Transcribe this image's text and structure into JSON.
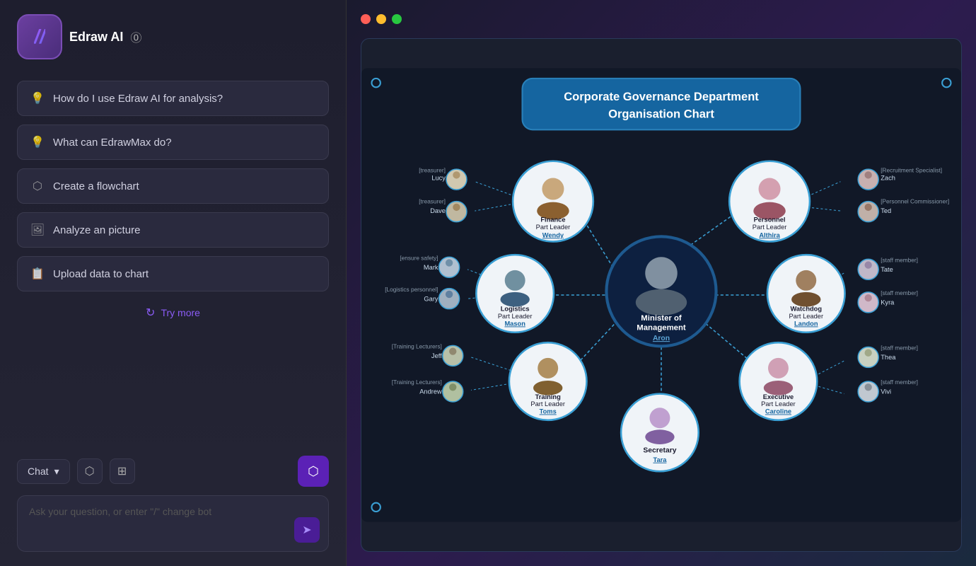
{
  "header": {
    "title": "Edraw AI",
    "help": "?"
  },
  "suggestions": [
    {
      "id": "analysis",
      "icon": "💡",
      "label": "How do I use Edraw AI for analysis?"
    },
    {
      "id": "edrawmax",
      "icon": "💡",
      "label": "What can EdrawMax do?"
    },
    {
      "id": "flowchart",
      "icon": "📊",
      "label": "Create a flowchart"
    },
    {
      "id": "picture",
      "icon": "🖼",
      "label": "Analyze an picture"
    },
    {
      "id": "upload",
      "icon": "📋",
      "label": "Upload data to chart"
    }
  ],
  "try_more": "Try more",
  "chat_label": "Chat",
  "input_placeholder": "Ask your question, or enter  \"/\"  change bot",
  "chart": {
    "title_line1": "Corporate Governance Department",
    "title_line2": "Organisation Chart",
    "center": {
      "role": "Minister of Management",
      "name": "Aron"
    },
    "departments": [
      {
        "id": "finance",
        "role": "Finance",
        "sub": "Part Leader",
        "name": "Wendy",
        "angle": "top-left"
      },
      {
        "id": "personnel",
        "role": "Personnel",
        "sub": "Part Leader",
        "name": "Althira",
        "angle": "top-right"
      },
      {
        "id": "logistics",
        "role": "Logistics",
        "sub": "Part Leader",
        "name": "Mason",
        "angle": "mid-left"
      },
      {
        "id": "watchdog",
        "role": "Watchdog",
        "sub": "Part Leader",
        "name": "Landon",
        "angle": "mid-right"
      },
      {
        "id": "training",
        "role": "Training",
        "sub": "Part Leader",
        "name": "Toms",
        "angle": "bot-left"
      },
      {
        "id": "executive",
        "role": "Executive",
        "sub": "Part Leader",
        "name": "Caroline",
        "angle": "bot-right"
      },
      {
        "id": "secretary",
        "role": "Secretary",
        "name": "Tara",
        "angle": "bottom"
      }
    ],
    "left_staff": [
      {
        "label": "[treasurer]",
        "name": "Lucy"
      },
      {
        "label": "[treasurer]",
        "name": "Dave"
      },
      {
        "label": "[ensure safety]",
        "name": "Mark"
      },
      {
        "label": "[Logistics personnel]",
        "name": "Gary"
      },
      {
        "label": "[Training Lecturers]",
        "name": "Jeff"
      },
      {
        "label": "[Training Lecturers]",
        "name": "Andrew"
      }
    ],
    "right_staff": [
      {
        "label": "[Recruitment Specialist]",
        "name": "Zach"
      },
      {
        "label": "[Personnel Commissioner]",
        "name": "Ted"
      },
      {
        "label": "[staff member]",
        "name": "Tate"
      },
      {
        "label": "[staff member]",
        "name": "Kyra"
      },
      {
        "label": "[staff member]",
        "name": "Thea"
      },
      {
        "label": "[staff member]",
        "name": "Vivi"
      }
    ]
  },
  "window_dots": [
    "#ff5f57",
    "#ffbd2e",
    "#28c840"
  ]
}
